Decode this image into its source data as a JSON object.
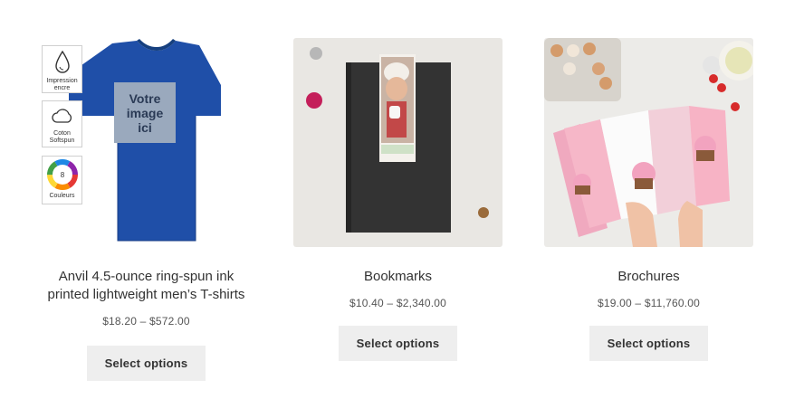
{
  "products": [
    {
      "title": "Anvil 4.5-ounce ring-spun ink printed lightweight men’s T-shirts",
      "price": "$18.20 – $572.00",
      "button_label": "Select options",
      "image": {
        "placeholder_text": "Votre image ici",
        "badges": [
          {
            "label": "Impression encre",
            "icon": "ink-drop-icon"
          },
          {
            "label": "Coton Softspun",
            "icon": "cloud-icon"
          },
          {
            "label": "Couleurs",
            "icon": "color-wheel-icon",
            "number": "8"
          }
        ]
      }
    },
    {
      "title": "Bookmarks",
      "price": "$10.40 – $2,340.00",
      "button_label": "Select options"
    },
    {
      "title": "Brochures",
      "price": "$19.00 – $11,760.00",
      "button_label": "Select options"
    }
  ],
  "colors": {
    "tshirt": "#1f4fa8",
    "button_bg": "#eeeeee",
    "text": "#333333"
  }
}
